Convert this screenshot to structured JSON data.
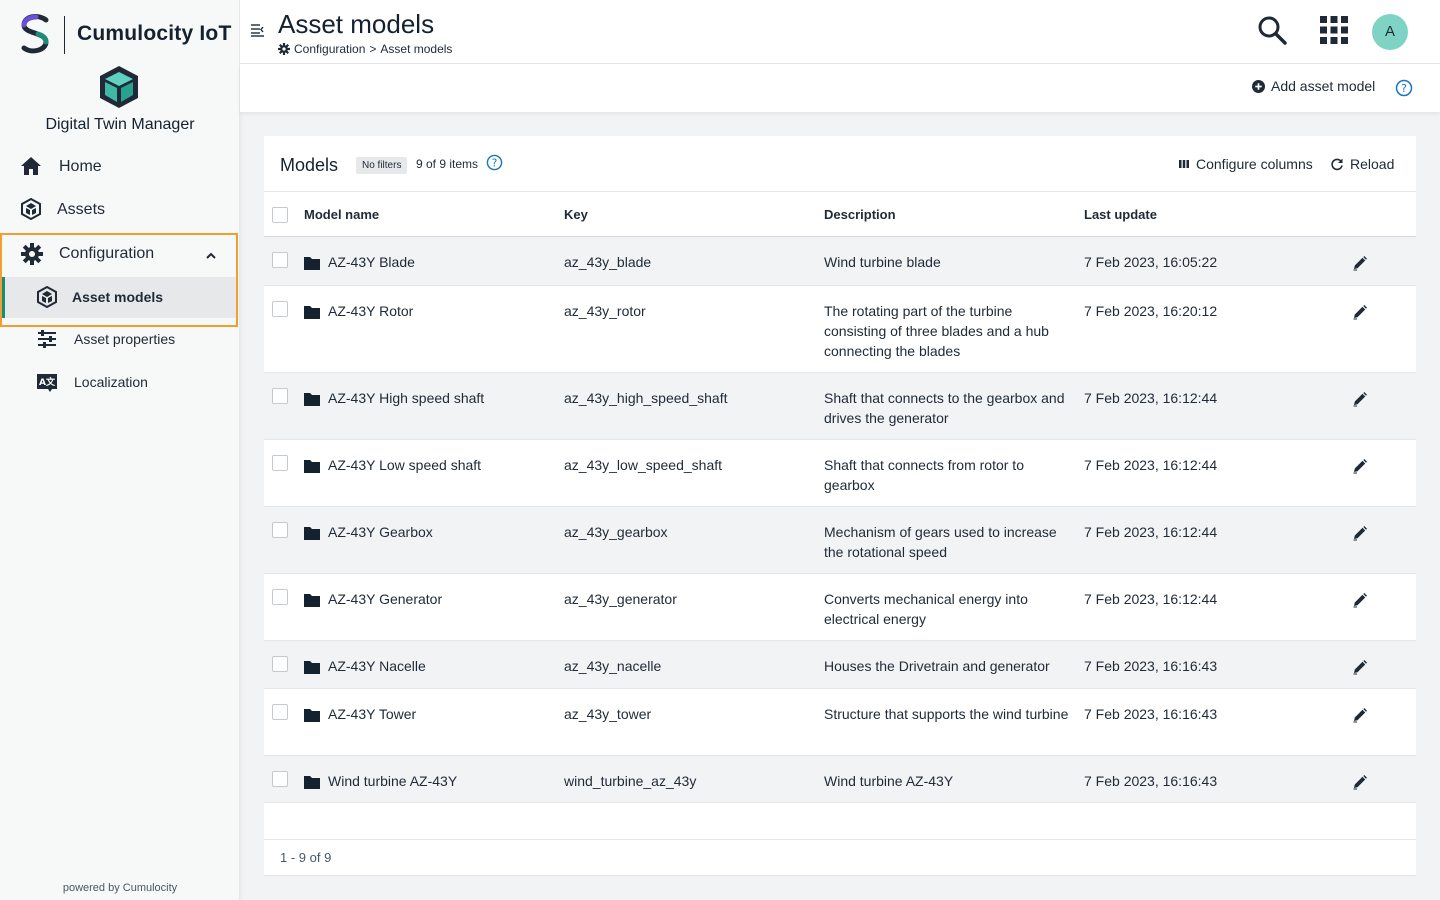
{
  "brand": {
    "name": "Cumulocity IoT",
    "app_name": "Digital Twin Manager",
    "powered_by": "powered by Cumulocity"
  },
  "nav": {
    "home": "Home",
    "assets": "Assets",
    "configuration": "Configuration",
    "asset_models": "Asset models",
    "asset_properties": "Asset properties",
    "localization": "Localization"
  },
  "header": {
    "title": "Asset models",
    "breadcrumb": {
      "parent": "Configuration",
      "separator": ">",
      "current": "Asset models"
    },
    "avatar_initial": "A"
  },
  "action_bar": {
    "add_label": "Add asset model"
  },
  "card": {
    "title": "Models",
    "filter_badge": "No filters",
    "count": "9 of 9 items",
    "configure_columns": "Configure columns",
    "reload": "Reload"
  },
  "table": {
    "columns": [
      "Model name",
      "Key",
      "Description",
      "Last update"
    ],
    "rows": [
      {
        "name": "AZ-43Y Blade",
        "key": "az_43y_blade",
        "description": "Wind turbine blade",
        "updated": "7 Feb 2023, 16:05:22"
      },
      {
        "name": "AZ-43Y Rotor",
        "key": "az_43y_rotor",
        "description": "The rotating part of the turbine consisting of three blades and a hub connecting the blades",
        "updated": "7 Feb 2023, 16:20:12"
      },
      {
        "name": "AZ-43Y High speed shaft",
        "key": "az_43y_high_speed_shaft",
        "description": "Shaft that connects to the gearbox and drives the generator",
        "updated": "7 Feb 2023, 16:12:44"
      },
      {
        "name": "AZ-43Y Low speed shaft",
        "key": "az_43y_low_speed_shaft",
        "description": "Shaft that connects from rotor to gearbox",
        "updated": "7 Feb 2023, 16:12:44"
      },
      {
        "name": "AZ-43Y Gearbox",
        "key": "az_43y_gearbox",
        "description": "Mechanism of gears used to increase the rotational speed",
        "updated": "7 Feb 2023, 16:12:44"
      },
      {
        "name": "AZ-43Y Generator",
        "key": "az_43y_generator",
        "description": "Converts mechanical energy into electrical energy",
        "updated": "7 Feb 2023, 16:12:44"
      },
      {
        "name": "AZ-43Y Nacelle",
        "key": "az_43y_nacelle",
        "description": "Houses the Drivetrain and generator",
        "updated": "7 Feb 2023, 16:16:43"
      },
      {
        "name": "AZ-43Y Tower",
        "key": "az_43y_tower",
        "description": "Structure that supports the wind turbine",
        "updated": "7 Feb 2023, 16:16:43"
      },
      {
        "name": "Wind turbine AZ-43Y",
        "key": "wind_turbine_az_43y",
        "description": "Wind turbine AZ-43Y",
        "updated": "7 Feb 2023, 16:16:43"
      }
    ]
  },
  "pager": {
    "text": "1 - 9 of 9"
  },
  "colors": {
    "accent": "#1c8c7a",
    "highlight_border": "#f0a030",
    "link_blue": "#1776bf",
    "avatar": "#7fd3c5"
  }
}
